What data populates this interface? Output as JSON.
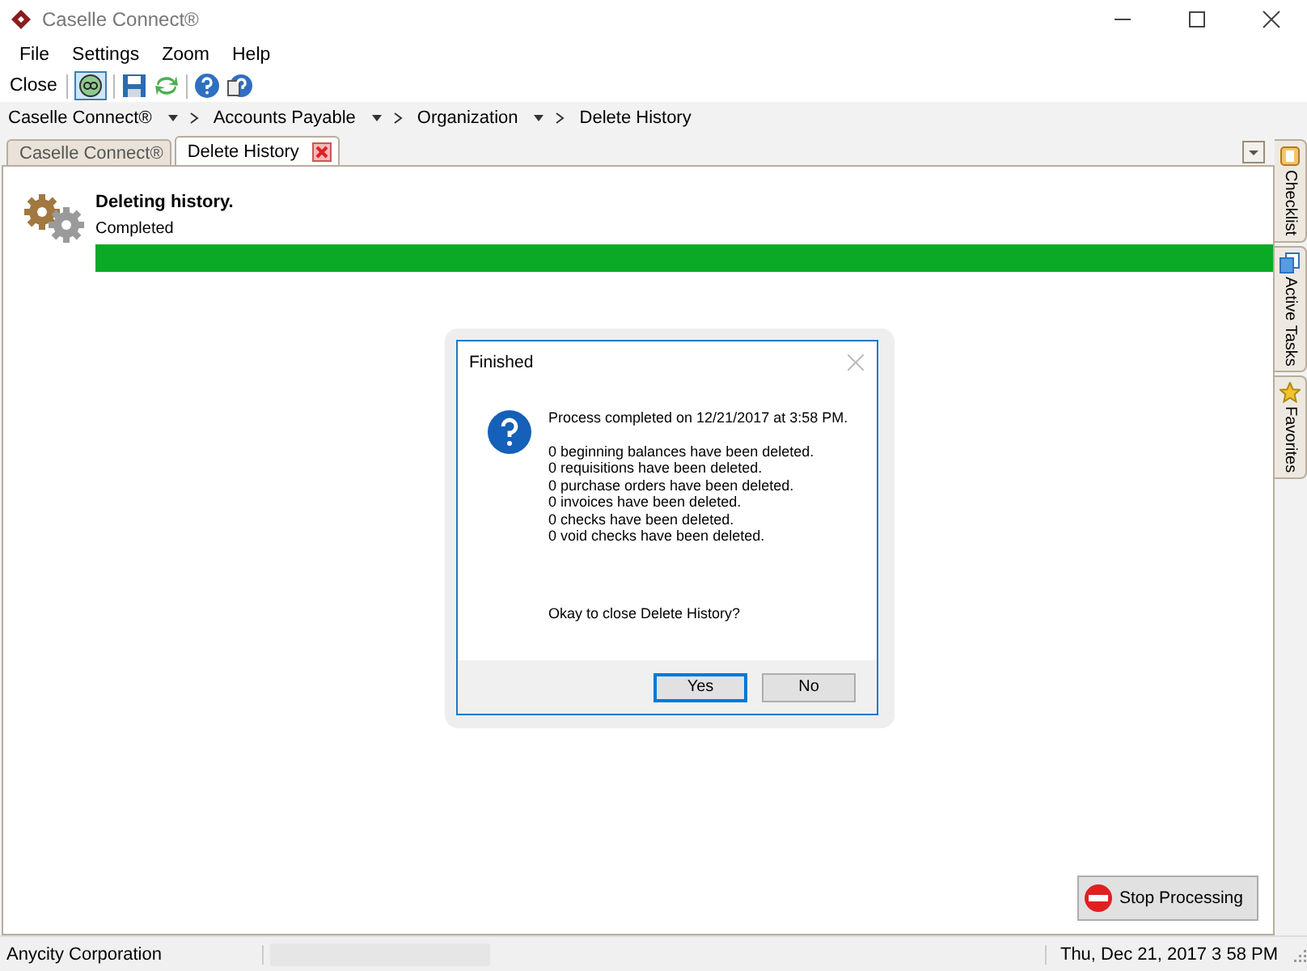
{
  "window": {
    "title": "Caselle Connect®"
  },
  "menu": [
    "File",
    "Settings",
    "Zoom",
    "Help"
  ],
  "toolbar": {
    "close_label": "Close",
    "icons": [
      {
        "kind": "go",
        "selected": true
      },
      {
        "kind": "save",
        "selected": false
      },
      {
        "kind": "refresh",
        "selected": false
      },
      {
        "kind": "help",
        "selected": false
      },
      {
        "kind": "help-book",
        "selected": false
      }
    ]
  },
  "breadcrumbs": [
    "Caselle Connect®",
    "Accounts Payable",
    "Organization",
    "Delete History"
  ],
  "tabs": [
    {
      "label": "Caselle Connect®",
      "selected": false,
      "closable": false
    },
    {
      "label": "Delete History",
      "selected": true,
      "closable": true
    }
  ],
  "progress": {
    "title": "Deleting history.",
    "status": "Completed",
    "level": 1
  },
  "dialog": {
    "title": "Finished",
    "message": "Process completed on 12/21/2017 at 3:58 PM.",
    "lines": [
      "0 beginning balances have been deleted.",
      "0 requisitions have been deleted.",
      "0 purchase orders have been deleted.",
      "0 invoices have been deleted.",
      "0 checks have been deleted.",
      "0 void checks have been deleted."
    ],
    "question": "Okay to close Delete History?",
    "buttons": [
      {
        "label": "Yes",
        "default": true
      },
      {
        "label": "No",
        "default": false
      }
    ]
  },
  "side_tabs": [
    {
      "kind": "checklist",
      "label": "Checklist"
    },
    {
      "kind": "tasks",
      "label": "Active Tasks"
    },
    {
      "kind": "star",
      "label": "Favorites"
    }
  ],
  "stop_button": "Stop Processing",
  "status_bar": {
    "company": "Anycity Corporation",
    "datetime": "Thu, Dec 21, 2017 3 58 PM"
  }
}
